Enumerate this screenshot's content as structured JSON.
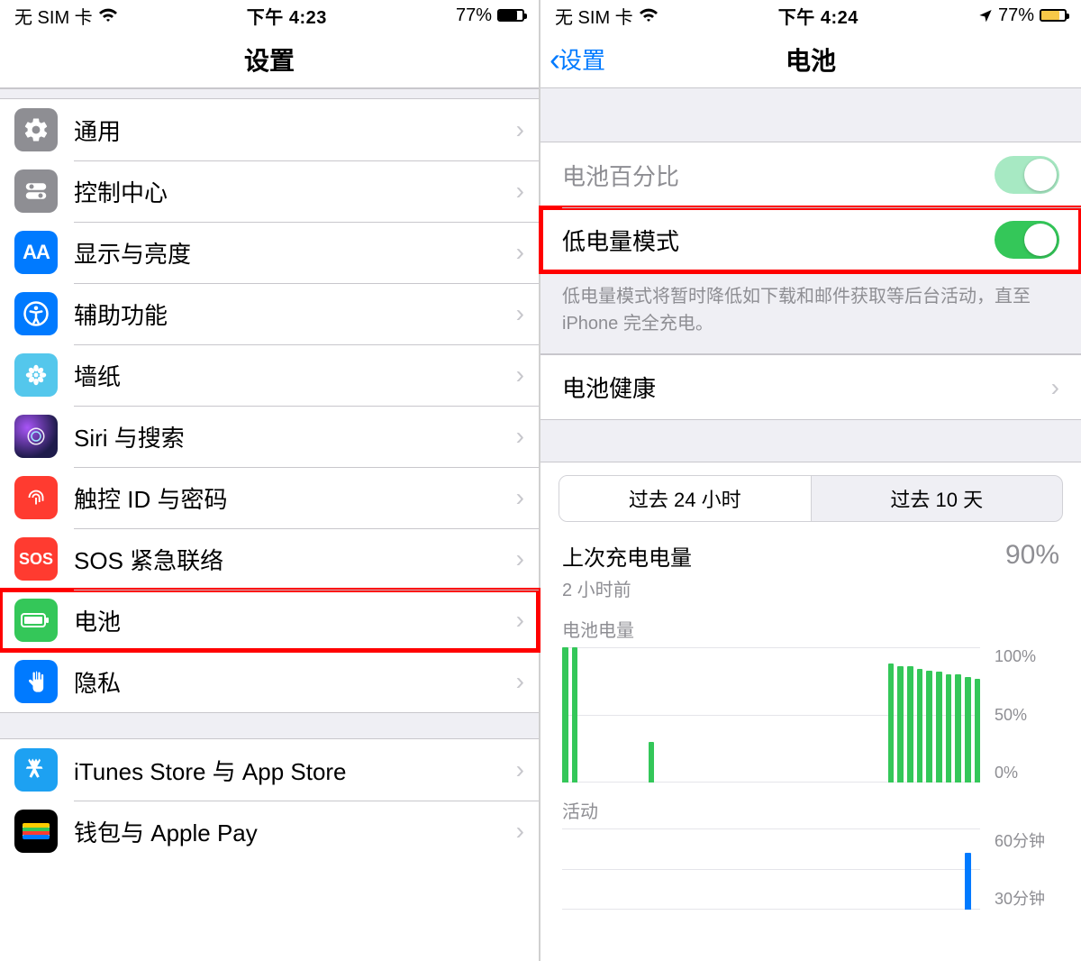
{
  "left": {
    "status": {
      "carrier": "无 SIM 卡",
      "time": "下午 4:23",
      "battery_pct": "77%"
    },
    "nav_title": "设置",
    "rows": {
      "general": "通用",
      "control_center": "控制中心",
      "display": "显示与亮度",
      "accessibility": "辅助功能",
      "wallpaper": "墙纸",
      "siri": "Siri 与搜索",
      "touchid": "触控 ID 与密码",
      "sos": "SOS 紧急联络",
      "battery": "电池",
      "privacy": "隐私",
      "itunes": "iTunes Store 与 App Store",
      "wallet": "钱包与 Apple Pay"
    },
    "icon_text": {
      "aa": "AA",
      "sos": "SOS"
    }
  },
  "right": {
    "status": {
      "carrier": "无 SIM 卡",
      "time": "下午 4:24",
      "battery_pct": "77%"
    },
    "nav_back": "设置",
    "nav_title": "电池",
    "rows": {
      "battery_percent": "电池百分比",
      "low_power": "低电量模式",
      "low_power_footer": "低电量模式将暂时降低如下载和邮件获取等后台活动，直至 iPhone 完全充电。",
      "battery_health": "电池健康"
    },
    "segmented": {
      "last24h": "过去 24 小时",
      "last10d": "过去 10 天"
    },
    "last_charge": {
      "title": "上次充电电量",
      "sub": "2 小时前",
      "value": "90%"
    },
    "charts": {
      "level_label": "电池电量",
      "level_ticks": {
        "t100": "100%",
        "t50": "50%",
        "t0": "0%"
      },
      "activity_label": "活动",
      "activity_ticks": {
        "t60": "60分钟",
        "t30": "30分钟"
      }
    }
  },
  "chart_data": {
    "type": "bar",
    "unit": "percent",
    "title": "电池电量",
    "ylim": [
      0,
      100
    ],
    "categories_hours": 24,
    "series": [
      {
        "name": "电池电量",
        "values": [
          100,
          100,
          0,
          0,
          0,
          0,
          0,
          0,
          0,
          30,
          0,
          0,
          0,
          0,
          0,
          0,
          0,
          0,
          0,
          0,
          0,
          0,
          0,
          0,
          0,
          0,
          0,
          0,
          0,
          0,
          0,
          0,
          0,
          0,
          88,
          86,
          86,
          84,
          83,
          82,
          80,
          80,
          78,
          77
        ]
      }
    ],
    "activity": {
      "title": "活动",
      "unit": "minutes",
      "ylim": [
        0,
        60
      ],
      "values": [
        0,
        0,
        0,
        0,
        0,
        0,
        0,
        0,
        0,
        0,
        0,
        0,
        0,
        0,
        0,
        0,
        0,
        0,
        0,
        0,
        0,
        0,
        0,
        0,
        0,
        0,
        0,
        0,
        0,
        0,
        0,
        0,
        0,
        0,
        0,
        0,
        0,
        0,
        0,
        0,
        0,
        0,
        42,
        0
      ]
    }
  }
}
